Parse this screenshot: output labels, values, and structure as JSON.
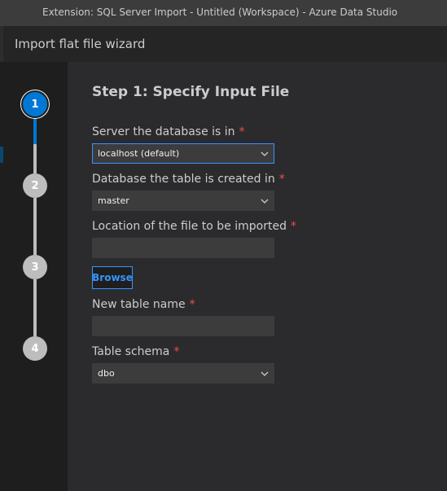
{
  "window": {
    "title": "Extension: SQL Server Import - Untitled (Workspace) - Azure Data Studio"
  },
  "dialog": {
    "title": "Import flat file wizard"
  },
  "steps": [
    {
      "number": "1",
      "active": true
    },
    {
      "number": "2",
      "active": false
    },
    {
      "number": "3",
      "active": false
    },
    {
      "number": "4",
      "active": false
    }
  ],
  "page": {
    "step_title": "Step 1: Specify Input File",
    "required_marker": "*",
    "server": {
      "label": "Server the database is in",
      "value": "localhost (default)"
    },
    "database": {
      "label": "Database the table is created in",
      "value": "master"
    },
    "file_location": {
      "label": "Location of the file to be imported",
      "value": ""
    },
    "browse_label": "Browse",
    "table_name": {
      "label": "New table name",
      "value": ""
    },
    "schema": {
      "label": "Table schema",
      "value": "dbo"
    }
  },
  "colors": {
    "accent": "#0078d4",
    "focus_border": "#3794ff",
    "required": "#f14c4c",
    "inactive_step": "#bdbdbd"
  }
}
